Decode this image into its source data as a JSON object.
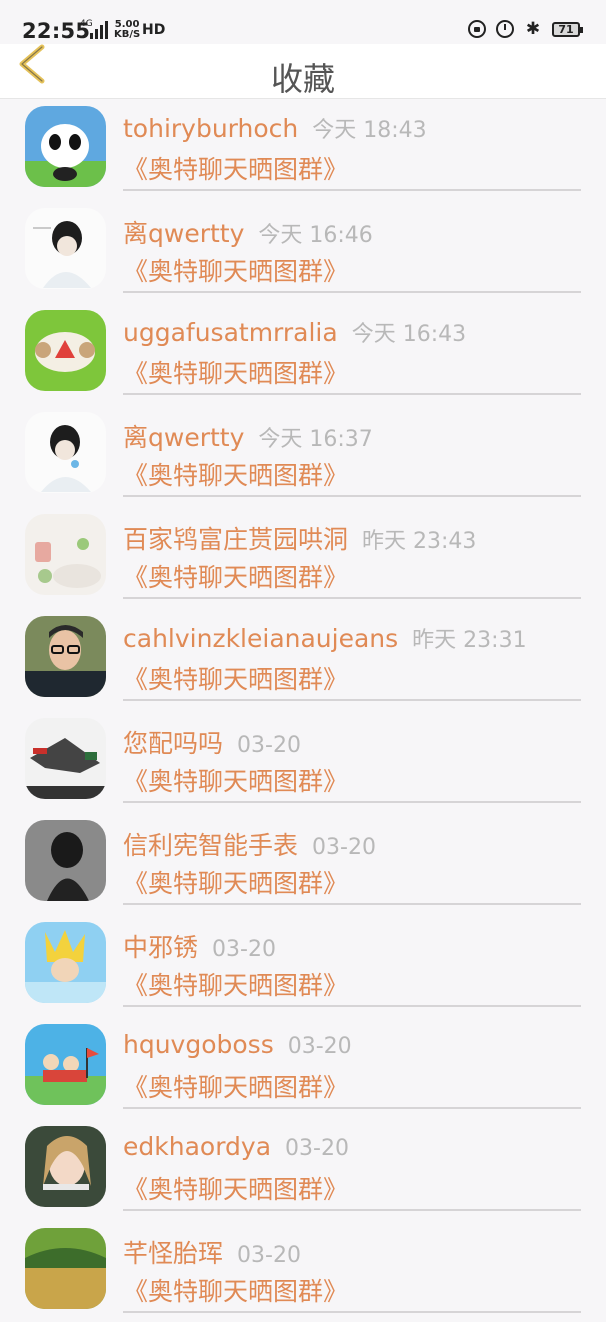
{
  "status_bar": {
    "time": "22:55",
    "network": "4G",
    "speed_value": "5.00",
    "speed_unit": "KB/S",
    "hd": "HD",
    "battery": "71"
  },
  "header": {
    "title": "收藏"
  },
  "favorites": [
    {
      "name": "tohiryburhoch",
      "time": "今天 18:43",
      "group": "《奥特聊天晒图群》"
    },
    {
      "name": "离qwertty",
      "time": "今天 16:46",
      "group": "《奥特聊天晒图群》"
    },
    {
      "name": "uggafusatmrralia",
      "time": "今天 16:43",
      "group": "《奥特聊天晒图群》"
    },
    {
      "name": "离qwertty",
      "time": "今天 16:37",
      "group": "《奥特聊天晒图群》"
    },
    {
      "name": "百家鸨富庄贳园哄洞",
      "time": "昨天 23:43",
      "group": "《奥特聊天晒图群》"
    },
    {
      "name": "cahlvinzkleianaujeans",
      "time": "昨天 23:31",
      "group": "《奥特聊天晒图群》"
    },
    {
      "name": "您配吗吗",
      "time": "03-20",
      "group": "《奥特聊天晒图群》"
    },
    {
      "name": "信利宪智能手表",
      "time": "03-20",
      "group": "《奥特聊天晒图群》"
    },
    {
      "name": "中邪锈",
      "time": "03-20",
      "group": "《奥特聊天晒图群》"
    },
    {
      "name": "hquvgoboss",
      "time": "03-20",
      "group": "《奥特聊天晒图群》"
    },
    {
      "name": "edkhaordya",
      "time": "03-20",
      "group": "《奥特聊天晒图群》"
    },
    {
      "name": "芊怪胎珲",
      "time": "03-20",
      "group": "《奥特聊天晒图群》"
    }
  ],
  "colors": {
    "accent": "#e08a55",
    "time_gray": "#b8b8b8",
    "back_arrow": "#e5c25a",
    "background": "#f7f6f8"
  }
}
